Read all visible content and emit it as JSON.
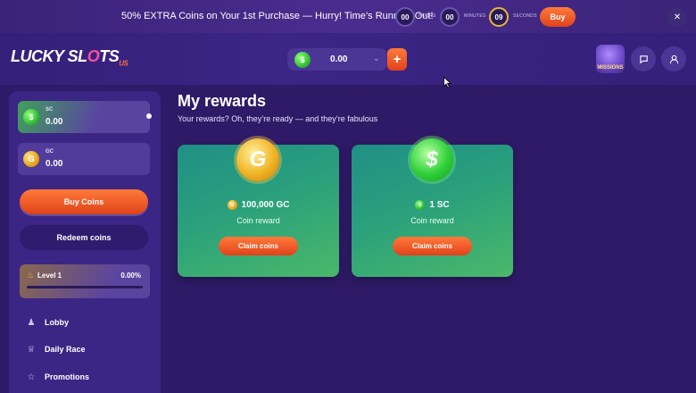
{
  "promo": {
    "text": "50% EXTRA Coins on Your 1st Purchase — Hurry! Time’s Running Out!",
    "hours": "00",
    "hours_label": "HOURS",
    "minutes": "00",
    "minutes_label": "MINUTES",
    "seconds": "09",
    "seconds_label": "SECONDS",
    "buy_label": "Buy",
    "close_icon": "close-icon"
  },
  "header": {
    "logo_part1": "LUCKY SL",
    "logo_accent": "O",
    "logo_part2": "TS",
    "logo_suffix": "US",
    "wallet_value": "0.00",
    "wallet_add": "+",
    "missions_label": "MISSIONS"
  },
  "sidebar": {
    "sc_label": "SC",
    "sc_value": "0.00",
    "gc_label": "GC",
    "gc_value": "0.00",
    "buy_label": "Buy Coins",
    "redeem_label": "Redeem coins",
    "level_label": "Level 1",
    "level_pct": "0.00%",
    "level_progress": 0,
    "nav": [
      {
        "label": "Lobby",
        "icon": "lobby-icon"
      },
      {
        "label": "Daily Race",
        "icon": "trophy-icon"
      },
      {
        "label": "Promotions",
        "icon": "star-icon"
      }
    ]
  },
  "main": {
    "title": "My rewards",
    "subtitle": "Your rewards? Oh, they’re ready — and they’re fabulous",
    "rewards": [
      {
        "coin_glyph": "G",
        "amount": "100,000 GC",
        "sub": "Coin reward",
        "button": "Claim coins"
      },
      {
        "coin_glyph": "$",
        "amount": "1 SC",
        "sub": "Coin reward",
        "button": "Claim coins"
      }
    ]
  },
  "colors": {
    "background": "#2e1a66",
    "accent_orange": "#e0421a",
    "card_green": "#2aa07c"
  }
}
